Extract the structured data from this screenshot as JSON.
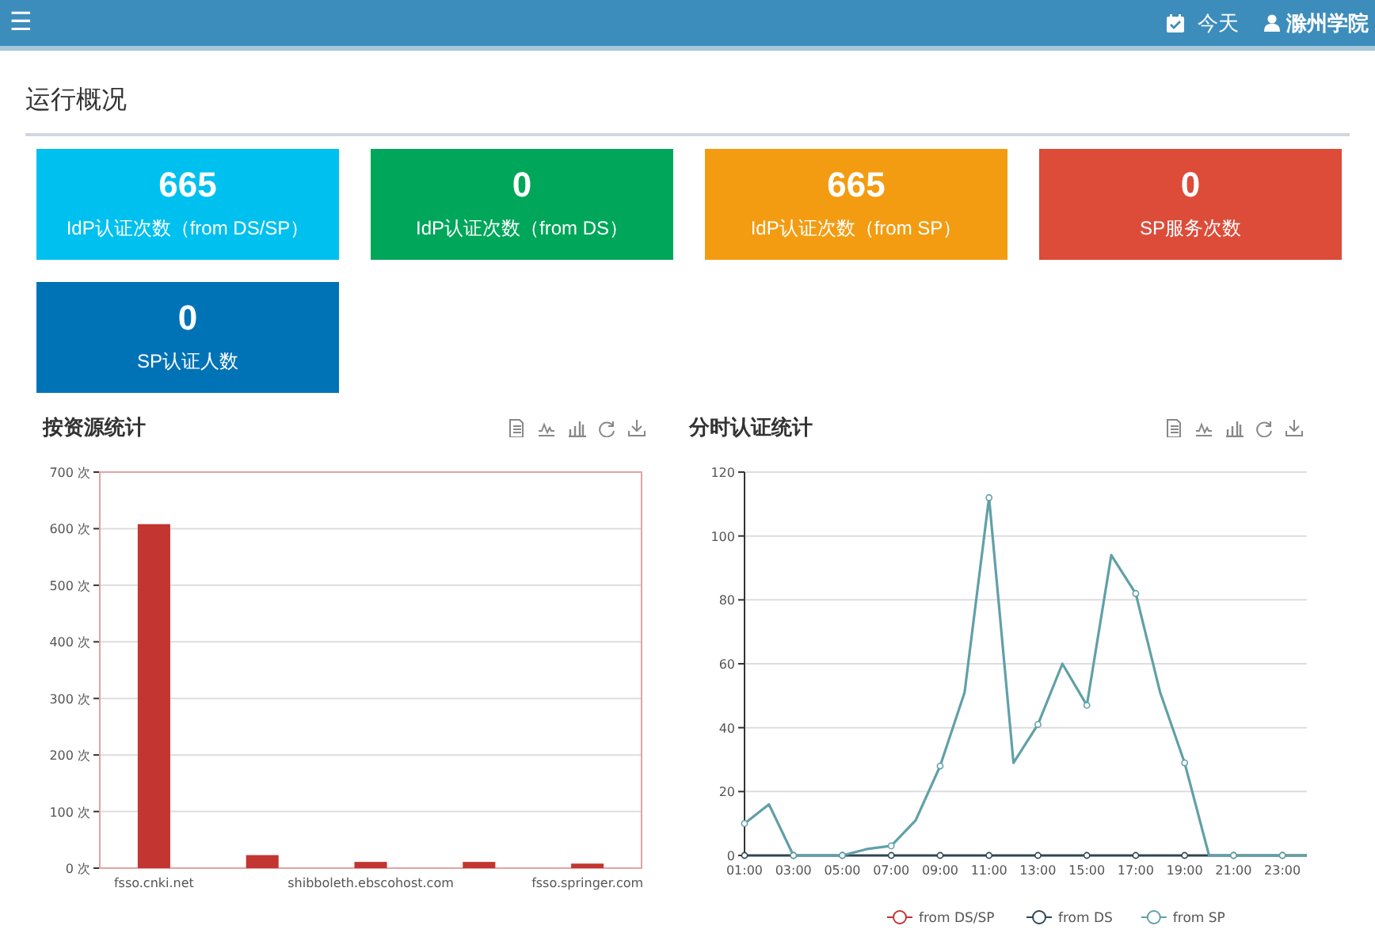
{
  "navbar": {
    "menu": "☰",
    "date_label": "今天",
    "user": "滁州学院"
  },
  "page_title": "运行概况",
  "stat_cards": [
    {
      "value": "665",
      "label": "IdP认证次数（from DS/SP）",
      "color": "#00c0ef"
    },
    {
      "value": "0",
      "label": "IdP认证次数（from DS）",
      "color": "#00a65a"
    },
    {
      "value": "665",
      "label": "IdP认证次数（from SP）",
      "color": "#f39c12"
    },
    {
      "value": "0",
      "label": "SP服务次数",
      "color": "#dd4b39"
    },
    {
      "value": "0",
      "label": "SP认证人数",
      "color": "#0073b7"
    }
  ],
  "panels": [
    {
      "title": "按资源统计",
      "chart_data": {
        "type": "bar",
        "categories": [
          "fsso.cnki.net",
          null,
          "shibboleth.ebscohost.com",
          null,
          "fsso.springer.com"
        ],
        "series": [
          {
            "color": "#c23531",
            "values": [
              608,
              23,
              11,
              11,
              8
            ]
          }
        ],
        "ylim": [
          0,
          700
        ],
        "grid": true,
        "yticks": [
          {
            "value": 0,
            "label": "0 次"
          },
          {
            "value": 100,
            "label": "100 次"
          },
          {
            "value": 200,
            "label": "200 次"
          },
          {
            "value": 300,
            "label": "300 次"
          },
          {
            "value": 400,
            "label": "400 次"
          },
          {
            "value": 500,
            "label": "500 次"
          },
          {
            "value": 600,
            "label": "600 次"
          },
          {
            "value": 700,
            "label": "700 次"
          }
        ]
      }
    },
    {
      "title": "分时认证统计",
      "chart_data": {
        "type": "line",
        "categories": [
          "01:00",
          null,
          "03:00",
          null,
          "05:00",
          null,
          "07:00",
          null,
          "09:00",
          null,
          "11:00",
          null,
          "13:00",
          null,
          "15:00",
          null,
          "17:00",
          null,
          "19:00",
          null,
          "21:00",
          null,
          "23:00",
          null
        ],
        "ylim": [
          0,
          120
        ],
        "grid": true,
        "legend": true,
        "yticks": [
          {
            "value": 0,
            "label": "0"
          },
          {
            "value": 20,
            "label": "20"
          },
          {
            "value": 40,
            "label": "40"
          },
          {
            "value": 60,
            "label": "60"
          },
          {
            "value": 80,
            "label": "80"
          },
          {
            "value": 100,
            "label": "100"
          },
          {
            "value": 120,
            "label": "120"
          }
        ],
        "series": [
          {
            "name": "from DS/SP",
            "color": "#c23531",
            "values": [
              null,
              null,
              null,
              null,
              null,
              null,
              null,
              null,
              null,
              null,
              null,
              null,
              null,
              null,
              null,
              null,
              null,
              null,
              null,
              null,
              null,
              null,
              null,
              null
            ]
          },
          {
            "name": "from DS",
            "color": "#2f4554",
            "values": [
              0,
              0,
              0,
              0,
              0,
              0,
              0,
              0,
              0,
              0,
              0,
              0,
              0,
              0,
              0,
              0,
              0,
              0,
              0,
              0,
              0,
              0,
              0,
              0
            ]
          },
          {
            "name": "from SP",
            "color": "#61a0a8",
            "values": [
              10,
              16,
              0,
              0,
              0,
              2,
              3,
              11,
              28,
              51,
              112,
              29,
              41,
              60,
              47,
              94,
              82,
              51,
              29,
              0,
              0,
              0,
              0,
              0
            ]
          }
        ]
      }
    }
  ]
}
